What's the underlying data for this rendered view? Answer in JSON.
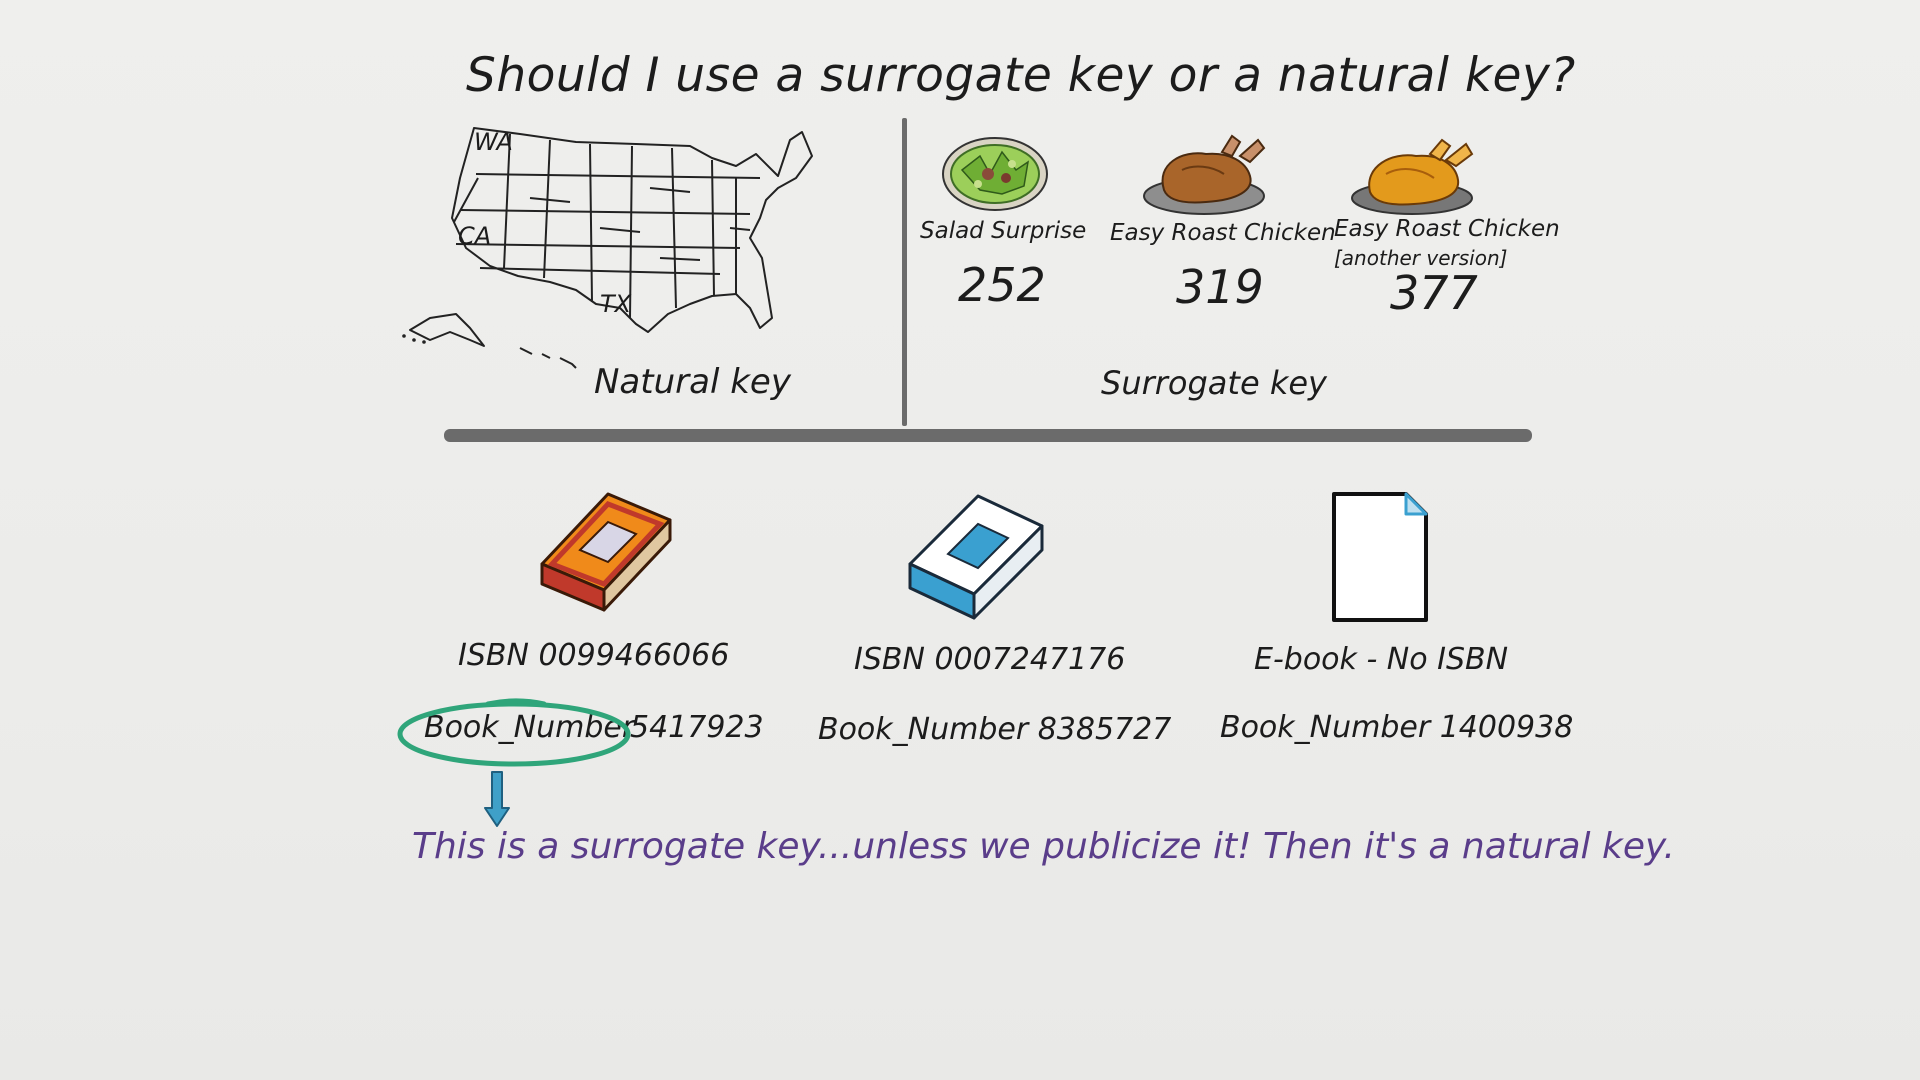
{
  "title": "Should I use a surrogate key or a natural key?",
  "natural_key": {
    "label": "Natural key",
    "map_labels": [
      "WA",
      "CA",
      "TX"
    ]
  },
  "surrogate_key": {
    "label": "Surrogate key",
    "dishes": [
      {
        "name": "Salad Surprise",
        "number": "252"
      },
      {
        "name": "Easy Roast Chicken",
        "number": "319"
      },
      {
        "name": "Easy Roast Chicken",
        "subtitle": "[another version]",
        "number": "377"
      }
    ]
  },
  "books": [
    {
      "isbn": "ISBN 0099466066",
      "book_number_label": "Book_Number",
      "book_number": "5417923"
    },
    {
      "isbn": "ISBN 0007247176",
      "book_number": "Book_Number 8385727"
    },
    {
      "isbn": "E-book - No ISBN",
      "book_number": "Book_Number 1400938"
    }
  ],
  "note": "This is a surrogate key...unless we publicize it! Then it's a natural key.",
  "colors": {
    "highlight_circle": "#2fa57a",
    "arrow": "#3fa0c8",
    "note_text": "#5a3d8a",
    "divider": "#6b6b6b"
  }
}
